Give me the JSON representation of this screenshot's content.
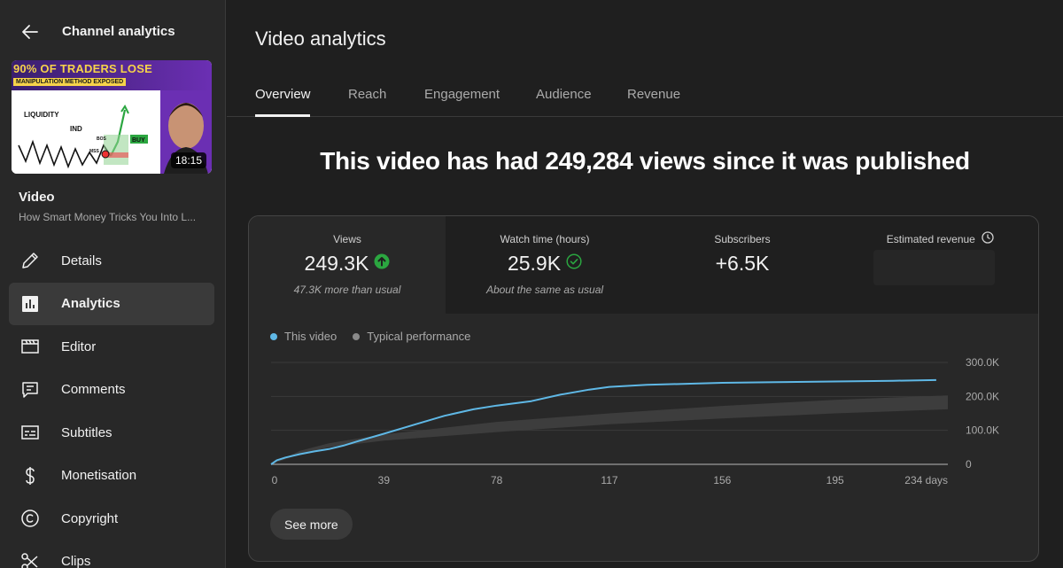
{
  "sidebar": {
    "header_title": "Channel analytics",
    "thumbnail": {
      "headline": "90% OF TRADERS LOSE",
      "subline": "MANIPULATION METHOD EXPOSED",
      "duration": "18:15",
      "art_labels": [
        "LIQUIDITY",
        "IND",
        "BOS",
        "MSS",
        "BUY"
      ]
    },
    "video_label": "Video",
    "video_title": "How Smart Money Tricks You Into L...",
    "items": [
      {
        "label": "Details",
        "icon": "pencil-icon"
      },
      {
        "label": "Analytics",
        "icon": "analytics-icon",
        "active": true
      },
      {
        "label": "Editor",
        "icon": "editor-icon"
      },
      {
        "label": "Comments",
        "icon": "comments-icon"
      },
      {
        "label": "Subtitles",
        "icon": "subtitles-icon"
      },
      {
        "label": "Monetisation",
        "icon": "dollar-icon"
      },
      {
        "label": "Copyright",
        "icon": "copyright-icon"
      },
      {
        "label": "Clips",
        "icon": "scissors-icon"
      }
    ]
  },
  "main": {
    "title": "Video analytics",
    "tabs": [
      "Overview",
      "Reach",
      "Engagement",
      "Audience",
      "Revenue"
    ],
    "active_tab": "Overview",
    "headline": "This video has had 249,284 views since it was published",
    "metrics": [
      {
        "label": "Views",
        "value": "249.3K",
        "sub": "47.3K more than usual",
        "status": "up"
      },
      {
        "label": "Watch time (hours)",
        "value": "25.9K",
        "sub": "About the same as usual",
        "status": "same"
      },
      {
        "label": "Subscribers",
        "value": "+6.5K",
        "sub": ""
      },
      {
        "label": "Estimated revenue",
        "value": "",
        "sub": ""
      }
    ],
    "see_more": "See more"
  },
  "colors": {
    "accent_line": "#5fb8e6",
    "typical_band": "#3d3d3d",
    "up_green": "#2ba640",
    "background": "#1f1f1f"
  },
  "chart_data": {
    "type": "line",
    "legend": [
      "This video",
      "Typical performance"
    ],
    "x_ticks": [
      "0",
      "39",
      "78",
      "117",
      "156",
      "195",
      "234 days"
    ],
    "y_ticks": [
      "300.0K",
      "200.0K",
      "100.0K",
      "0"
    ],
    "xlim": [
      0,
      234
    ],
    "ylim": [
      0,
      300000
    ],
    "series": [
      {
        "name": "This video",
        "x": [
          0,
          2,
          5,
          10,
          15,
          20,
          25,
          30,
          39,
          50,
          60,
          70,
          78,
          90,
          100,
          110,
          117,
          130,
          156,
          175,
          195,
          215,
          230
        ],
        "y": [
          0,
          12000,
          20000,
          30000,
          38000,
          45000,
          55000,
          68000,
          90000,
          118000,
          143000,
          162000,
          173000,
          186000,
          205000,
          220000,
          228000,
          234000,
          240000,
          242000,
          244000,
          246000,
          248000
        ]
      }
    ],
    "typical_band": {
      "name": "Typical performance",
      "x": [
        0,
        10,
        20,
        39,
        78,
        117,
        156,
        195,
        234
      ],
      "low": [
        0,
        30000,
        50000,
        70000,
        95000,
        118000,
        135000,
        150000,
        162000
      ],
      "high": [
        0,
        40000,
        62000,
        88000,
        125000,
        150000,
        172000,
        190000,
        203000
      ]
    }
  }
}
